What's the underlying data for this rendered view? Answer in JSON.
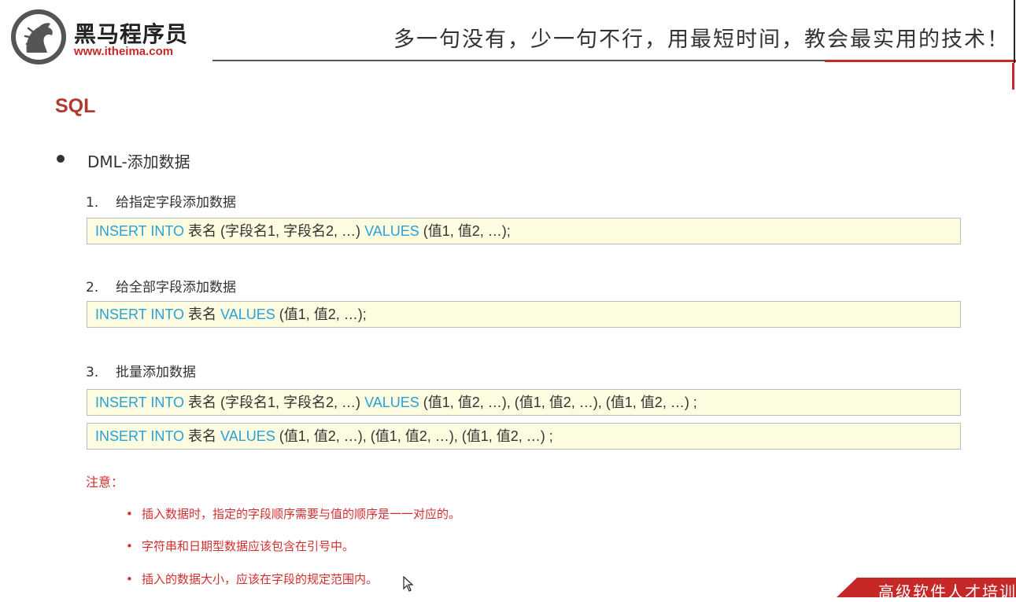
{
  "header": {
    "brand_name": "黑马程序员",
    "brand_url": "www.itheima.com",
    "slogan": "多一句没有，少一句不行，用最短时间，教会最实用的技术！"
  },
  "page_title": "SQL",
  "section_title": "DML-添加数据",
  "steps": [
    {
      "num": "1.",
      "label": "给指定字段添加数据",
      "code_parts": [
        "INSERT INTO",
        " 表名 (字段名1, 字段名2, …) ",
        "VALUES",
        " (值1, 值2, …);"
      ]
    },
    {
      "num": "2.",
      "label": "给全部字段添加数据",
      "code_parts": [
        "INSERT INTO",
        " 表名 ",
        "VALUES",
        " (值1, 值2, …);"
      ]
    },
    {
      "num": "3.",
      "label": "批量添加数据",
      "code_parts": [
        "INSERT INTO",
        " 表名 (字段名1, 字段名2, …) ",
        "VALUES",
        " (值1, 值2, …), (值1, 值2, …), (值1, 值2, …) ;"
      ],
      "code_parts_2": [
        "INSERT INTO",
        " 表名 ",
        "VALUES",
        " (值1, 值2, …), (值1, 值2, …), (值1, 值2, …) ;"
      ]
    }
  ],
  "notes": {
    "title": "注意：",
    "bullet": "•",
    "items": [
      "插入数据时，指定的字段顺序需要与值的顺序是一一对应的。",
      "字符串和日期型数据应该包含在引号中。",
      "插入的数据大小，应该在字段的规定范围内。"
    ]
  },
  "corner_banner": "高级软件人才培训",
  "colors": {
    "keyword": "#2aa0d8",
    "accent_red": "#c62828",
    "title_red": "#b03a2e",
    "code_bg": "#fdfbe0"
  }
}
